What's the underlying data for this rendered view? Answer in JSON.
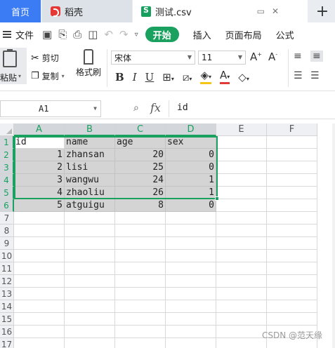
{
  "tabs": {
    "home": "首页",
    "doc": "稻壳",
    "file": "测试.csv",
    "add": "+"
  },
  "menu": {
    "file": "文件",
    "start": "开始",
    "insert": "插入",
    "layout": "页面布局",
    "formula": "公式"
  },
  "ribbon": {
    "paste": "粘贴",
    "cut": "剪切",
    "copy": "复制",
    "format_painter": "格式刷",
    "font_name": "宋体",
    "font_size": "11"
  },
  "formula_bar": {
    "cell_ref": "A1",
    "fx": "fx",
    "value": "id"
  },
  "columns": [
    "A",
    "B",
    "C",
    "D",
    "E",
    "F"
  ],
  "rows": [
    "1",
    "2",
    "3",
    "4",
    "5",
    "6",
    "7",
    "8",
    "9",
    "10",
    "11",
    "12",
    "13",
    "14",
    "15",
    "16",
    "17"
  ],
  "table": [
    [
      "id",
      "name",
      "age",
      "sex"
    ],
    [
      "1",
      "zhansan",
      "20",
      "0"
    ],
    [
      "2",
      "lisi",
      "25",
      "0"
    ],
    [
      "3",
      "wangwu",
      "24",
      "1"
    ],
    [
      "4",
      "zhaoliu",
      "26",
      "1"
    ],
    [
      "5",
      "atguigu",
      "8",
      "0"
    ]
  ],
  "watermark": "CSDN @范天缘",
  "colors": {
    "accent": "#1aa15f",
    "home_tab": "#3b7cf5",
    "selection_fill": "#d4d4d4"
  }
}
